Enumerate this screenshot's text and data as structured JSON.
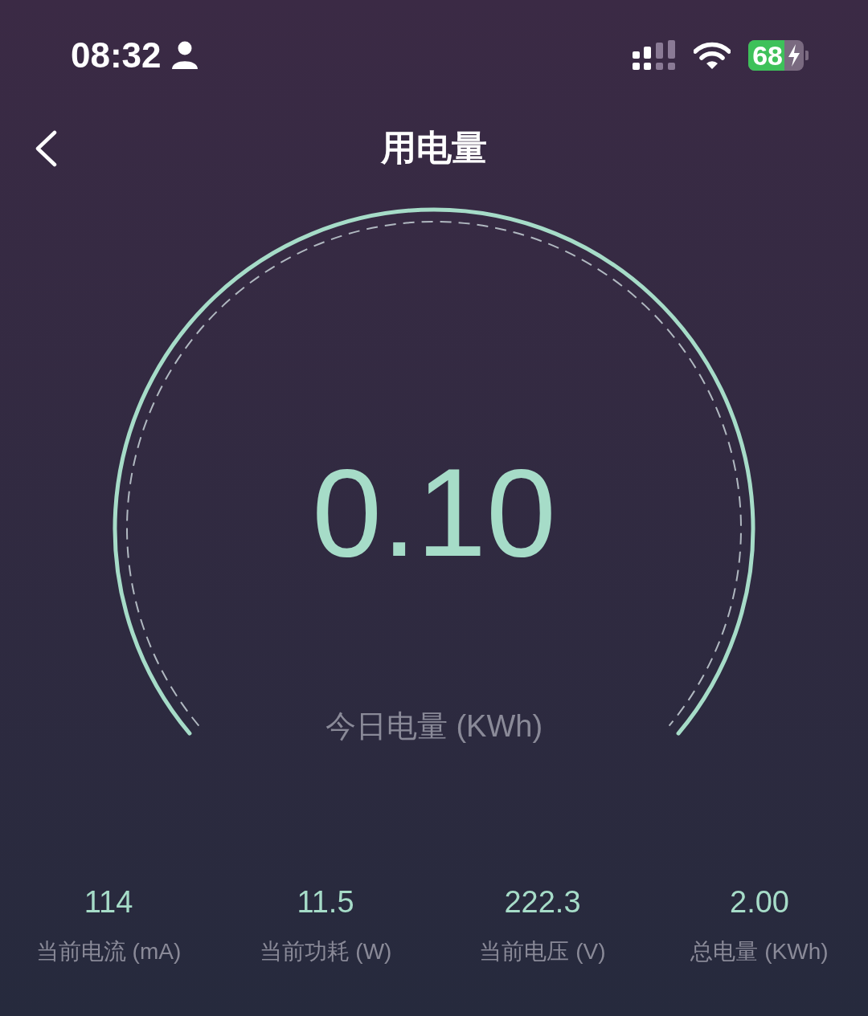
{
  "status_bar": {
    "time": "08:32",
    "battery": "68"
  },
  "header": {
    "title": "用电量"
  },
  "gauge": {
    "value": "0.10",
    "label": "今日电量 (KWh)"
  },
  "stats": [
    {
      "value": "114",
      "label": "当前电流 (mA)"
    },
    {
      "value": "11.5",
      "label": "当前功耗 (W)"
    },
    {
      "value": "222.3",
      "label": "当前电压 (V)"
    },
    {
      "value": "2.00",
      "label": "总电量 (KWh)"
    }
  ]
}
